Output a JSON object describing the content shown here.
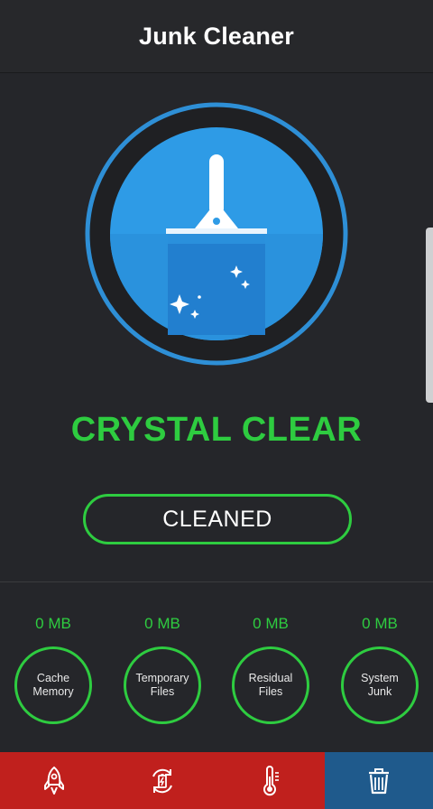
{
  "header": {
    "title": "Junk Cleaner"
  },
  "status": {
    "headline": "CRYSTAL CLEAR",
    "button_label": "CLEANED"
  },
  "stats": [
    {
      "value": "0 MB",
      "line1": "Cache",
      "line2": "Memory"
    },
    {
      "value": "0 MB",
      "line1": "Temporary",
      "line2": "Files"
    },
    {
      "value": "0 MB",
      "line1": "Residual",
      "line2": "Files"
    },
    {
      "value": "0 MB",
      "line1": "System",
      "line2": "Junk"
    }
  ],
  "bottom_nav": [
    {
      "icon": "rocket-icon",
      "active": false
    },
    {
      "icon": "battery-sync-icon",
      "active": false
    },
    {
      "icon": "thermometer-icon",
      "active": false
    },
    {
      "icon": "trash-icon",
      "active": true
    }
  ],
  "colors": {
    "accent_green": "#2ecc40",
    "nav_red": "#c0201d",
    "nav_active_blue": "#1f5a8c",
    "emblem_blue": "#2e9be6",
    "background": "#25262a"
  }
}
